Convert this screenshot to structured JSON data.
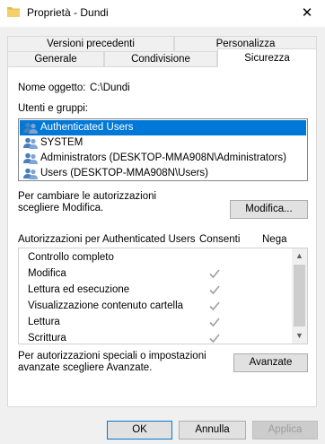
{
  "window": {
    "title": "Proprietà - Dundi",
    "close": "✕"
  },
  "tabs": {
    "row1": [
      "Versioni precedenti",
      "Personalizza"
    ],
    "row2": [
      "Generale",
      "Condivisione",
      "Sicurezza"
    ]
  },
  "object": {
    "label": "Nome oggetto:",
    "value": "C:\\Dundi"
  },
  "users": {
    "label": "Utenti e gruppi:",
    "items": [
      "Authenticated Users",
      "SYSTEM",
      "Administrators (DESKTOP-MMA908N\\Administrators)",
      "Users (DESKTOP-MMA908N\\Users)"
    ],
    "selected_index": 0
  },
  "change_hint": {
    "line1": "Per cambiare le autorizzazioni",
    "line2": "scegliere Modifica."
  },
  "buttons": {
    "modifica": "Modifica...",
    "avanzate": "Avanzate",
    "ok": "OK",
    "annulla": "Annulla",
    "applica": "Applica"
  },
  "permissions": {
    "header": "Autorizzazioni per Authenticated Users",
    "allow_col": "Consenti",
    "deny_col": "Nega",
    "rows": [
      {
        "name": "Controllo completo",
        "allow": false
      },
      {
        "name": "Modifica",
        "allow": true
      },
      {
        "name": "Lettura ed esecuzione",
        "allow": true
      },
      {
        "name": "Visualizzazione contenuto cartella",
        "allow": true
      },
      {
        "name": "Lettura",
        "allow": true
      },
      {
        "name": "Scrittura",
        "allow": true
      }
    ]
  },
  "advanced_hint": {
    "line1": "Per autorizzazioni speciali o impostazioni",
    "line2": "avanzate scegliere Avanzate."
  },
  "colors": {
    "selection": "#0078d7",
    "check": "#a0a0a0"
  }
}
